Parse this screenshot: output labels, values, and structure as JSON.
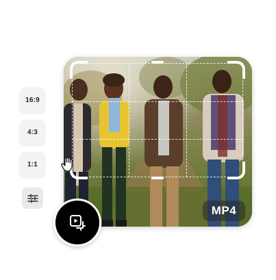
{
  "aspect_ratios": {
    "items": [
      {
        "label": "16:9"
      },
      {
        "label": "4:3"
      },
      {
        "label": "1:1"
      }
    ],
    "settings_icon": "sliders-icon"
  },
  "media": {
    "format_label": "MP4",
    "scene": "four people walking on an autumn path",
    "crop_overlay": "rule-of-thirds grid with corner handles"
  },
  "action_button": {
    "icon": "video-crop-icon"
  },
  "cursor": {
    "icon": "hand-cursor-icon"
  },
  "colors": {
    "sidebar_button_bg": "#f3f3f3",
    "action_button_bg": "#000000",
    "badge_bg": "rgba(40,40,40,0.55)",
    "crop_lines": "#ffffff"
  }
}
